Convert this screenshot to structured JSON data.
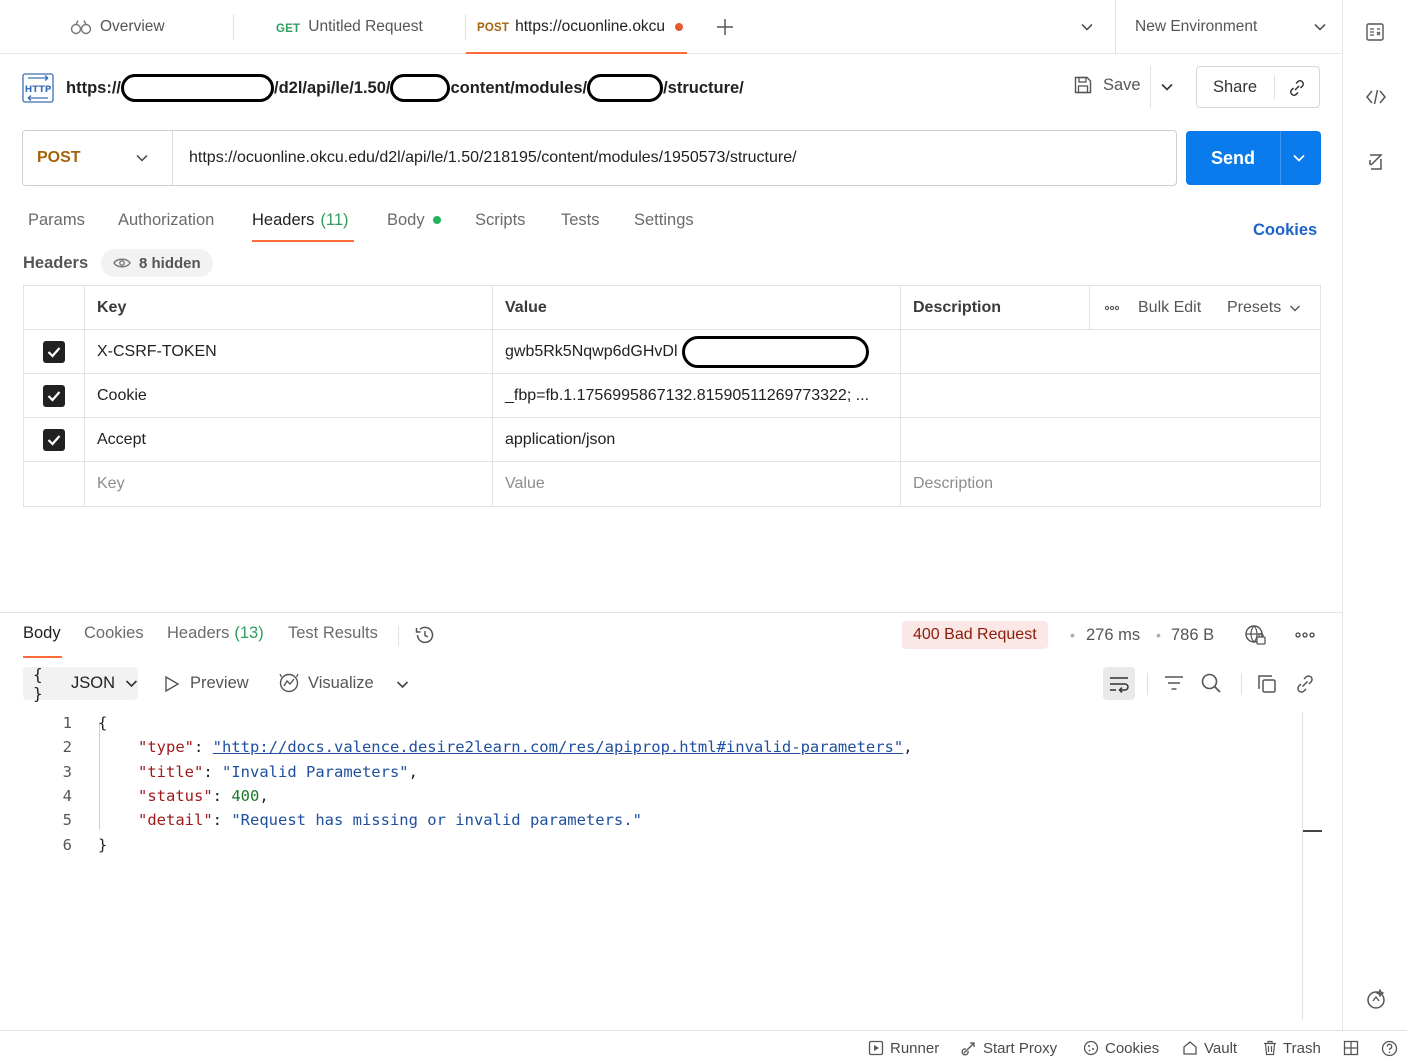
{
  "tabs": {
    "overview": "Overview",
    "untitled_method": "GET",
    "untitled_label": "Untitled Request",
    "active_method": "POST",
    "active_label": "https://ocuonline.okcu",
    "environment": "New Environment"
  },
  "title": {
    "part1": "https://",
    "part2": "/d2l/api/le/1.50/",
    "part3": "content/modules/",
    "part4": "/structure/",
    "save": "Save",
    "share": "Share"
  },
  "request": {
    "method": "POST",
    "url": "https://ocuonline.okcu.edu/d2l/api/le/1.50/218195/content/modules/1950573/structure/",
    "send": "Send"
  },
  "req_tabs": {
    "params": "Params",
    "authorization": "Authorization",
    "headers": "Headers",
    "headers_count": "(11)",
    "body": "Body",
    "scripts": "Scripts",
    "tests": "Tests",
    "settings": "Settings",
    "cookies": "Cookies"
  },
  "headers_section": {
    "title": "Headers",
    "hidden": "8 hidden",
    "col_key": "Key",
    "col_value": "Value",
    "col_description": "Description",
    "bulk_edit": "Bulk Edit",
    "presets": "Presets",
    "rows": [
      {
        "key": "X-CSRF-TOKEN",
        "value": "gwb5Rk5Nqwp6dGHvDl"
      },
      {
        "key": "Cookie",
        "value": "_fbp=fb.1.1756995867132.81590511269773322; ..."
      },
      {
        "key": "Accept",
        "value": "application/json"
      }
    ],
    "placeholder_key": "Key",
    "placeholder_value": "Value",
    "placeholder_description": "Description"
  },
  "response": {
    "tabs": {
      "body": "Body",
      "cookies": "Cookies",
      "headers": "Headers",
      "headers_count": "(13)",
      "test_results": "Test Results"
    },
    "status": "400 Bad Request",
    "time": "276 ms",
    "size": "786 B",
    "format": "JSON",
    "preview": "Preview",
    "visualize": "Visualize",
    "lines": [
      "1",
      "2",
      "3",
      "4",
      "5",
      "6"
    ],
    "json": {
      "open": "{",
      "close": "}",
      "type_key": "\"type\"",
      "type_val": "\"http://docs.valence.desire2learn.com/res/apiprop.html#invalid-parameters\"",
      "title_key": "\"title\"",
      "title_val": "\"Invalid Parameters\"",
      "status_key": "\"status\"",
      "status_val": "400",
      "detail_key": "\"detail\"",
      "detail_val": "\"Request has missing or invalid parameters.\""
    }
  },
  "statusbar": {
    "runner": "Runner",
    "start_proxy": "Start Proxy",
    "cookies": "Cookies",
    "vault": "Vault",
    "trash": "Trash"
  },
  "colors": {
    "accent": "#ff6c37",
    "send": "#097bed",
    "post_method": "#a4630a",
    "get_method": "#2f9e5e",
    "error_bg": "#fbe7e5"
  }
}
